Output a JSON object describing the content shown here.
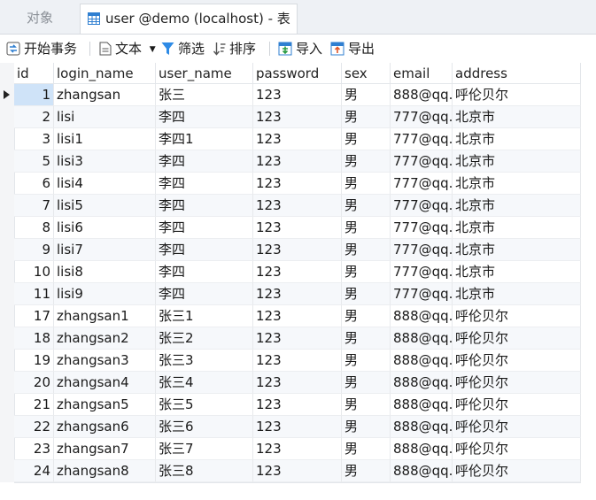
{
  "tabs": {
    "objects": "对象",
    "table_tab": "user @demo (localhost) - 表"
  },
  "toolbar": {
    "begin_transaction": "开始事务",
    "text": "文本",
    "filter": "筛选",
    "sort": "排序",
    "import": "导入",
    "export": "导出"
  },
  "columns": [
    "id",
    "login_name",
    "user_name",
    "password",
    "sex",
    "email",
    "address"
  ],
  "rows": [
    [
      "1",
      "zhangsan",
      "张三",
      "123",
      "男",
      "888@qq.",
      "呼伦贝尔"
    ],
    [
      "2",
      "lisi",
      "李四",
      "123",
      "男",
      "777@qq.",
      "北京市"
    ],
    [
      "3",
      "lisi1",
      "李四1",
      "123",
      "男",
      "777@qq.",
      "北京市"
    ],
    [
      "5",
      "lisi3",
      "李四",
      "123",
      "男",
      "777@qq.",
      "北京市"
    ],
    [
      "6",
      "lisi4",
      "李四",
      "123",
      "男",
      "777@qq.",
      "北京市"
    ],
    [
      "7",
      "lisi5",
      "李四",
      "123",
      "男",
      "777@qq.",
      "北京市"
    ],
    [
      "8",
      "lisi6",
      "李四",
      "123",
      "男",
      "777@qq.",
      "北京市"
    ],
    [
      "9",
      "lisi7",
      "李四",
      "123",
      "男",
      "777@qq.",
      "北京市"
    ],
    [
      "10",
      "lisi8",
      "李四",
      "123",
      "男",
      "777@qq.",
      "北京市"
    ],
    [
      "11",
      "lisi9",
      "李四",
      "123",
      "男",
      "777@qq.",
      "北京市"
    ],
    [
      "17",
      "zhangsan1",
      "张三1",
      "123",
      "男",
      "888@qq.",
      "呼伦贝尔"
    ],
    [
      "18",
      "zhangsan2",
      "张三2",
      "123",
      "男",
      "888@qq.",
      "呼伦贝尔"
    ],
    [
      "19",
      "zhangsan3",
      "张三3",
      "123",
      "男",
      "888@qq.",
      "呼伦贝尔"
    ],
    [
      "20",
      "zhangsan4",
      "张三4",
      "123",
      "男",
      "888@qq.",
      "呼伦贝尔"
    ],
    [
      "21",
      "zhangsan5",
      "张三5",
      "123",
      "男",
      "888@qq.",
      "呼伦贝尔"
    ],
    [
      "22",
      "zhangsan6",
      "张三6",
      "123",
      "男",
      "888@qq.",
      "呼伦贝尔"
    ],
    [
      "23",
      "zhangsan7",
      "张三7",
      "123",
      "男",
      "888@qq.",
      "呼伦贝尔"
    ],
    [
      "24",
      "zhangsan8",
      "张三8",
      "123",
      "男",
      "888@qq.",
      "呼伦贝尔"
    ]
  ],
  "icons": {
    "table_tab": "table-icon",
    "begin_transaction": "transaction-icon",
    "text": "document-icon",
    "filter": "filter-icon",
    "sort": "sort-icon",
    "import": "import-icon",
    "export": "export-icon",
    "row_marker": "current-row-arrow-icon"
  },
  "colors": {
    "accent": "#2f7fd1",
    "selection": "#cfe3f8",
    "filter": "#2e8be6"
  },
  "selected_row": 0
}
